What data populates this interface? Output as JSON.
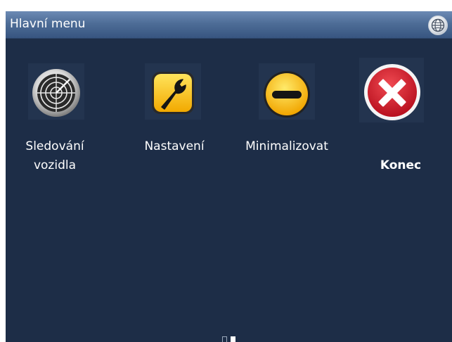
{
  "window": {
    "title": "Hlavní menu",
    "globe_icon": "globe-icon"
  },
  "menu": {
    "items": [
      {
        "label_line1": "Sledování",
        "label_line2": "vozidla",
        "icon": "radar-icon"
      },
      {
        "label_line1": "Nastavení",
        "icon": "wrench-icon"
      },
      {
        "label_line1": "Minimalizovat",
        "icon": "minus-icon"
      },
      {
        "label_line1": "Konec",
        "icon": "close-icon"
      }
    ]
  },
  "pager": {
    "pages": 2,
    "current": 2
  },
  "colors": {
    "background": "#1d2d47",
    "titlebar": "#4e6d97",
    "accent_yellow": "#f5b800",
    "close_red": "#d41f2e"
  }
}
